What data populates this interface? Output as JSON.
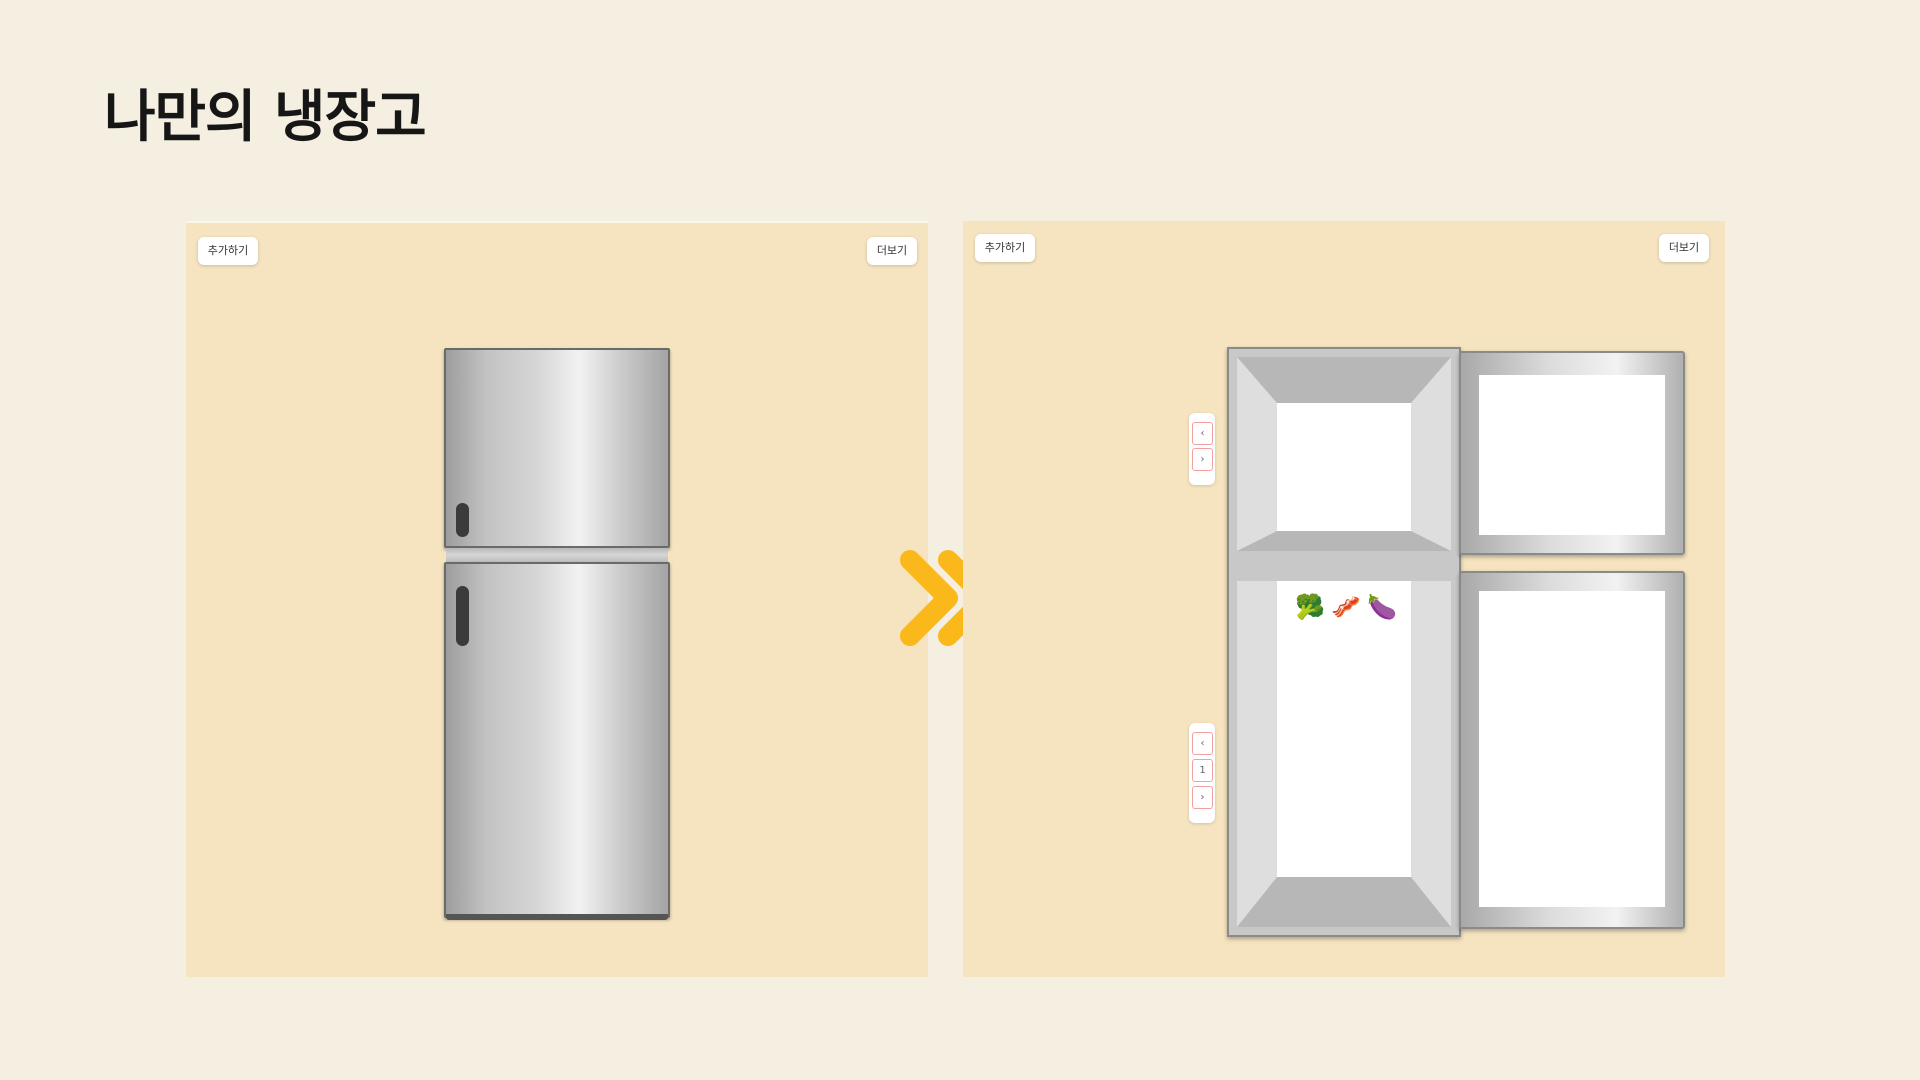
{
  "page": {
    "title": "나만의 냉장고"
  },
  "left_panel": {
    "add_button": "추가하기",
    "more_button": "더보기"
  },
  "right_panel": {
    "add_button": "추가하기",
    "more_button": "더보기",
    "freezer_pager": {
      "prev": "‹",
      "next": "›"
    },
    "fridge_pager": {
      "prev": "‹",
      "page": "1",
      "next": "›"
    },
    "foods": [
      {
        "name": "broccoli",
        "glyph": "🥦"
      },
      {
        "name": "bacon",
        "glyph": "🥓"
      },
      {
        "name": "eggplant",
        "glyph": "🍆"
      }
    ]
  },
  "colors": {
    "background": "#f4efe0",
    "panel": "#f5e4bf",
    "arrow": "#fbb81a"
  },
  "icons": [
    "double-chevron-right-icon"
  ]
}
